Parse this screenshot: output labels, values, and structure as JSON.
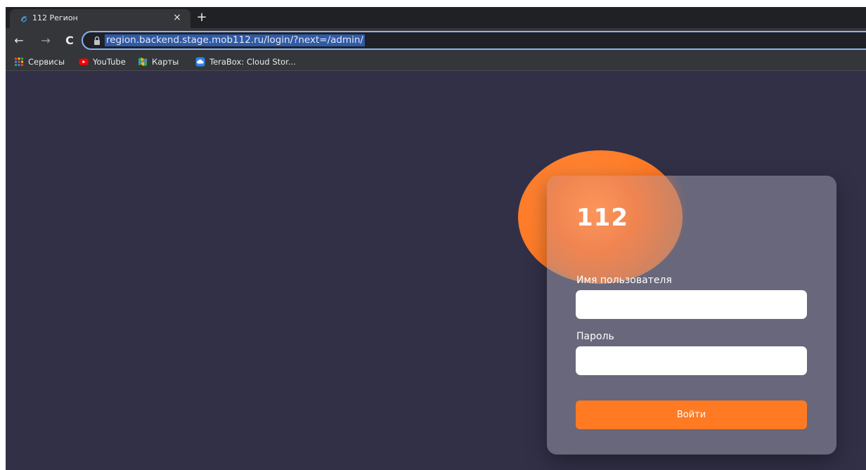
{
  "browser": {
    "tab": {
      "title": "112 Регион",
      "close_glyph": "×",
      "favicon": "site-favicon-icon"
    },
    "new_tab_glyph": "+",
    "nav": {
      "back_glyph": "←",
      "forward_glyph": "→",
      "reload_glyph": "C"
    },
    "address_bar": {
      "url": "region.backend.stage.mob112.ru/login/?next=/admin/"
    },
    "bookmarks": [
      {
        "label": "Сервисы",
        "icon": "apps-grid-icon"
      },
      {
        "label": "YouTube",
        "icon": "youtube-icon"
      },
      {
        "label": "Карты",
        "icon": "maps-icon"
      },
      {
        "label": "TeraBox: Cloud Stor...",
        "icon": "terabox-icon"
      }
    ]
  },
  "login": {
    "brand": "112",
    "username_label": "Имя пользователя",
    "username_value": "",
    "password_label": "Пароль",
    "password_value": "",
    "submit_label": "Войти"
  },
  "colors": {
    "page_bg": "#313047",
    "accent": "#ff7a22",
    "card": "rgba(150,150,165,0.55)"
  }
}
